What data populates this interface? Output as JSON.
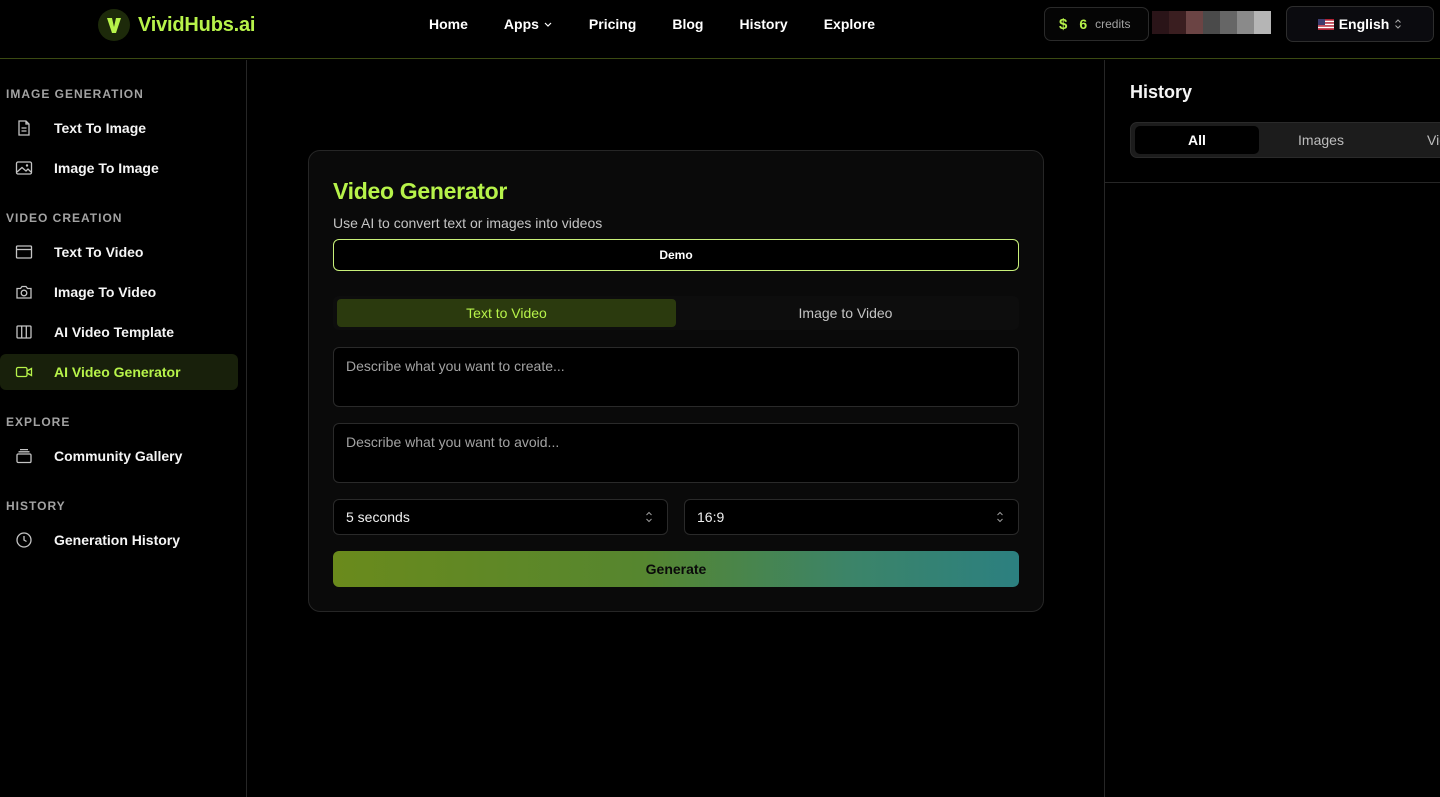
{
  "brand": {
    "name": "VividHubs.ai",
    "accent": "#b7f34a"
  },
  "nav": {
    "items": [
      "Home",
      "Apps",
      "Pricing",
      "Blog",
      "History",
      "Explore"
    ]
  },
  "credits": {
    "symbol": "$",
    "count": "6",
    "label": "credits"
  },
  "language": {
    "label": "English",
    "flag": "us-flag"
  },
  "sidebar": {
    "sections": [
      {
        "title": "IMAGE GENERATION",
        "items": [
          {
            "label": "Text To Image",
            "icon": "document-icon"
          },
          {
            "label": "Image To Image",
            "icon": "image-icon"
          }
        ]
      },
      {
        "title": "VIDEO CREATION",
        "items": [
          {
            "label": "Text To Video",
            "icon": "browser-window-icon"
          },
          {
            "label": "Image To Video",
            "icon": "camera-icon"
          },
          {
            "label": "AI Video Template",
            "icon": "columns-icon"
          },
          {
            "label": "AI Video Generator",
            "icon": "video-camera-icon",
            "active": true
          }
        ]
      },
      {
        "title": "EXPLORE",
        "items": [
          {
            "label": "Community Gallery",
            "icon": "gallery-stack-icon"
          }
        ]
      },
      {
        "title": "HISTORY",
        "items": [
          {
            "label": "Generation History",
            "icon": "clock-icon"
          }
        ]
      }
    ]
  },
  "generator": {
    "title": "Video Generator",
    "subtitle": "Use AI to convert text or images into videos",
    "demo_label": "Demo",
    "tabs": [
      "Text to Video",
      "Image to Video"
    ],
    "active_tab": "Text to Video",
    "prompt_placeholder": "Describe what you want to create...",
    "negative_placeholder": "Describe what you want to avoid...",
    "duration": "5 seconds",
    "aspect_ratio": "16:9",
    "generate_label": "Generate"
  },
  "history": {
    "title": "History",
    "tabs": [
      "All",
      "Images",
      "Vid"
    ],
    "active_tab": "All"
  }
}
